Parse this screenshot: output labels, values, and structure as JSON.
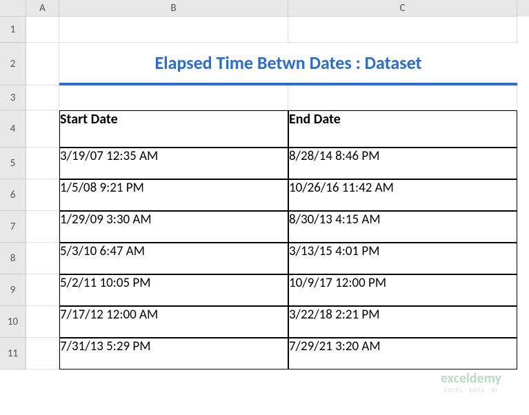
{
  "columns": {
    "a": "A",
    "b": "B",
    "c": "C"
  },
  "rows": {
    "r1": "1",
    "r2": "2",
    "r3": "3",
    "r4": "4",
    "r5": "5",
    "r6": "6",
    "r7": "7",
    "r8": "8",
    "r9": "9",
    "r10": "10",
    "r11": "11"
  },
  "title": "Elapsed Time Betwn Dates : Dataset",
  "headers": {
    "start": "Start Date",
    "end": "End Date"
  },
  "data": [
    {
      "start": "3/19/07 12:35 AM",
      "end": "8/28/14 8:46 PM"
    },
    {
      "start": "1/5/08 9:21 PM",
      "end": "10/26/16 11:42 AM"
    },
    {
      "start": "1/29/09 3:30 AM",
      "end": "8/30/13 4:15 AM"
    },
    {
      "start": "5/3/10 6:47 AM",
      "end": "3/13/15 4:01 PM"
    },
    {
      "start": "5/2/11 10:05 PM",
      "end": "10/9/17 12:00 PM"
    },
    {
      "start": "7/17/12 12:00 AM",
      "end": "3/22/18 2:21 PM"
    },
    {
      "start": "7/31/13 5:29 PM",
      "end": "7/29/21 3:20 AM"
    }
  ],
  "watermark": {
    "brand": "exceldemy",
    "tagline": "EXCEL · DATA · BI"
  },
  "chart_data": {
    "type": "table",
    "title": "Elapsed Time Betwn Dates : Dataset",
    "columns": [
      "Start Date",
      "End Date"
    ],
    "rows": [
      [
        "3/19/07 12:35 AM",
        "8/28/14 8:46 PM"
      ],
      [
        "1/5/08 9:21 PM",
        "10/26/16 11:42 AM"
      ],
      [
        "1/29/09 3:30 AM",
        "8/30/13 4:15 AM"
      ],
      [
        "5/3/10 6:47 AM",
        "3/13/15 4:01 PM"
      ],
      [
        "5/2/11 10:05 PM",
        "10/9/17 12:00 PM"
      ],
      [
        "7/17/12 12:00 AM",
        "3/22/18 2:21 PM"
      ],
      [
        "7/31/13 5:29 PM",
        "7/29/21 3:20 AM"
      ]
    ]
  }
}
